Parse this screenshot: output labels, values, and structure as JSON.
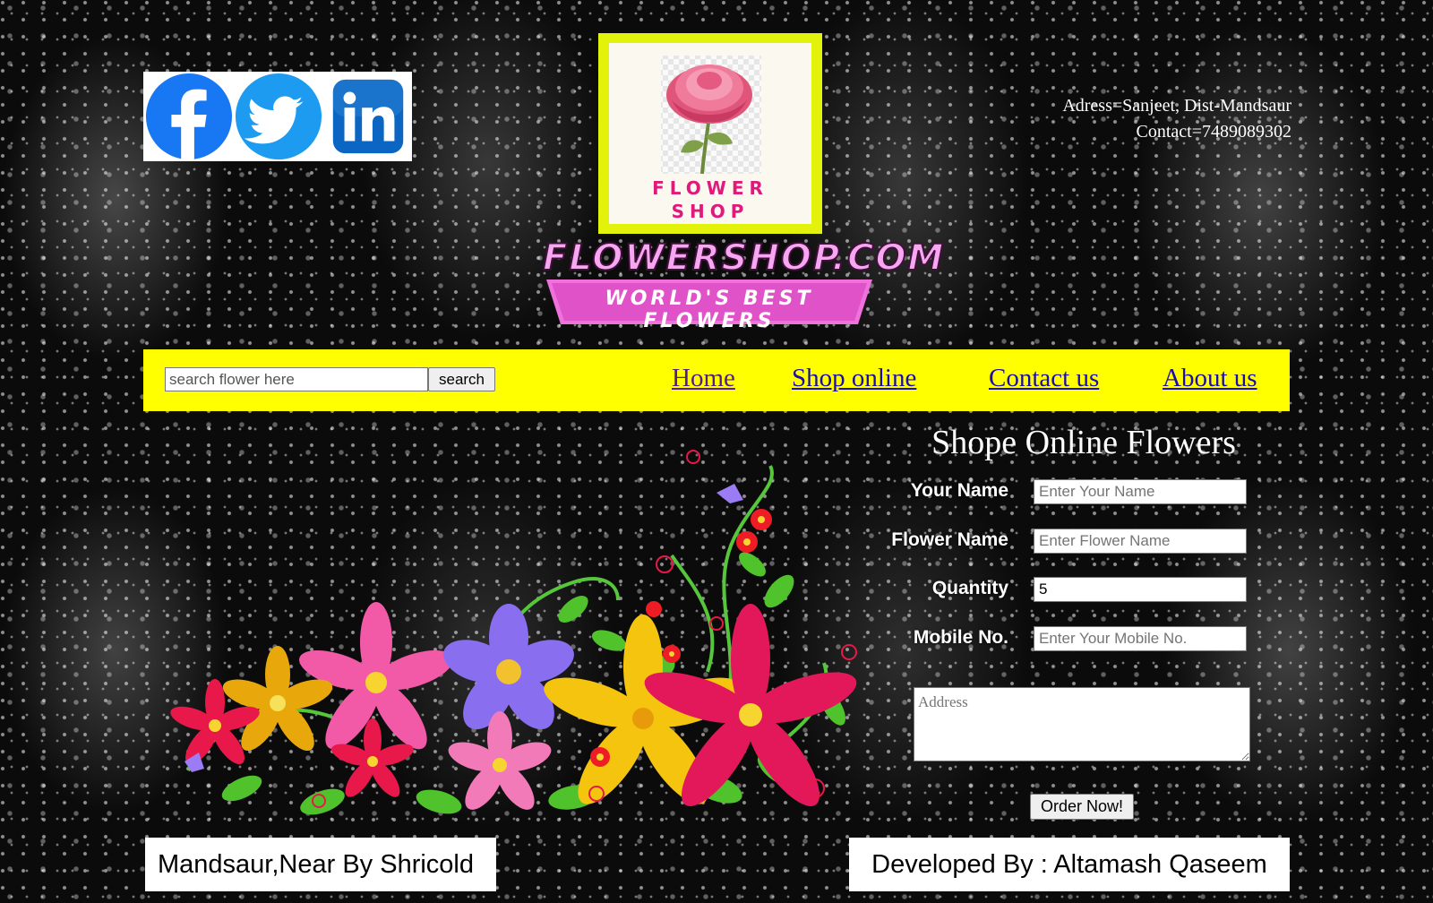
{
  "social": {
    "icons": [
      "facebook-icon",
      "twitter-icon",
      "linkedin-icon"
    ],
    "colors": {
      "facebook": "#1877f2",
      "twitter": "#1d9bf0",
      "linkedin": "#0a66c2"
    }
  },
  "logo": {
    "line1": "FLOWER",
    "line2": "SHOP",
    "brand_name": "FLOWERSHOP.COM",
    "tagline": "WORLD'S BEST FLOWERS"
  },
  "contact": {
    "address": "Adress=Sanjeet, Dist-Mandsaur",
    "phone": "Contact=7489089302"
  },
  "nav": {
    "search_placeholder": "search flower here",
    "search_button": "search",
    "links": [
      "Home",
      "Shop online",
      "Contact us",
      "About us"
    ]
  },
  "order_form": {
    "title": "Shope Online Flowers",
    "fields": [
      {
        "label": "Your Name",
        "placeholder": "Enter Your Name",
        "value": ""
      },
      {
        "label": "Flower Name",
        "placeholder": "Enter Flower Name",
        "value": ""
      },
      {
        "label": "Quantity",
        "placeholder": "",
        "value": "5"
      },
      {
        "label": "Mobile No.",
        "placeholder": "Enter Your Mobile No.",
        "value": ""
      }
    ],
    "address_placeholder": "Address",
    "submit": "Order Now!"
  },
  "footer": {
    "left": "Mandsaur,Near By Shricold",
    "right": "Developed By : Altamash Qaseem"
  },
  "colors": {
    "nav_bg": "#ffff00",
    "logo_frame": "#e2f20a",
    "brand_pink": "#f070dc",
    "link": "#1a0dab",
    "link_visited": "#551a8b"
  }
}
